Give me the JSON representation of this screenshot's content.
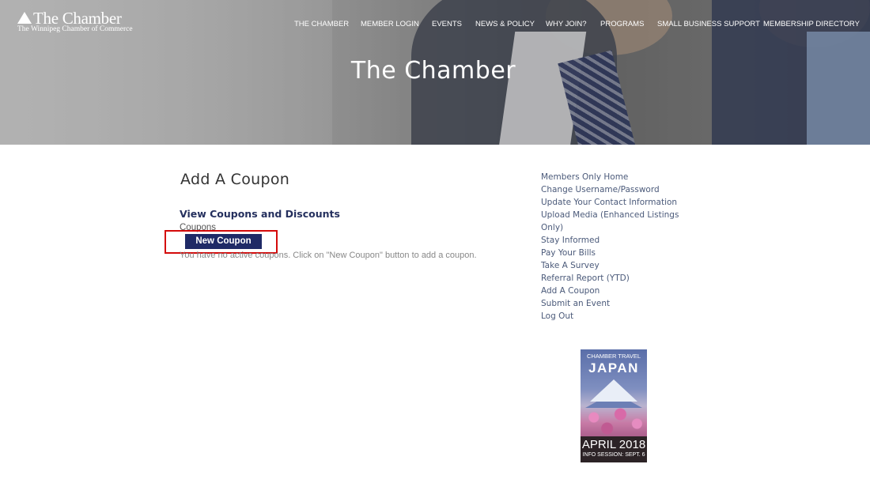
{
  "header": {
    "logo_name": "The Chamber",
    "logo_tagline": "The Winnipeg Chamber of Commerce",
    "nav": [
      "THE CHAMBER",
      "MEMBER LOGIN",
      "EVENTS",
      "NEWS & POLICY",
      "WHY JOIN?",
      "PROGRAMS",
      "SMALL BUSINESS SUPPORT",
      "MEMBERSHIP DIRECTORY"
    ],
    "hero_title": "The Chamber"
  },
  "main": {
    "page_title": "Add A Coupon",
    "section_title": "View Coupons and Discounts",
    "sub_label": "Coupons",
    "new_coupon_label": "New Coupon",
    "empty_message": "You have no active coupons. Click on \"New Coupon\" button to add a coupon."
  },
  "sidebar": {
    "links": [
      "Members Only Home",
      "Change Username/Password",
      "Update Your Contact Information",
      "Upload Media (Enhanced Listings",
      "Only)",
      "Stay Informed",
      "Pay Your Bills",
      "Take A Survey",
      "Referral Report (YTD)",
      "Add A Coupon",
      "Submit an Event",
      "Log Out"
    ]
  },
  "ad": {
    "top": "CHAMBER TRAVEL",
    "headline": "JAPAN",
    "date": "APRIL 2018",
    "info": "INFO SESSION: SEPT. 6"
  },
  "colors": {
    "accent": "#1f2a66",
    "highlight": "#d40a0a",
    "link": "#4b5a7a"
  }
}
